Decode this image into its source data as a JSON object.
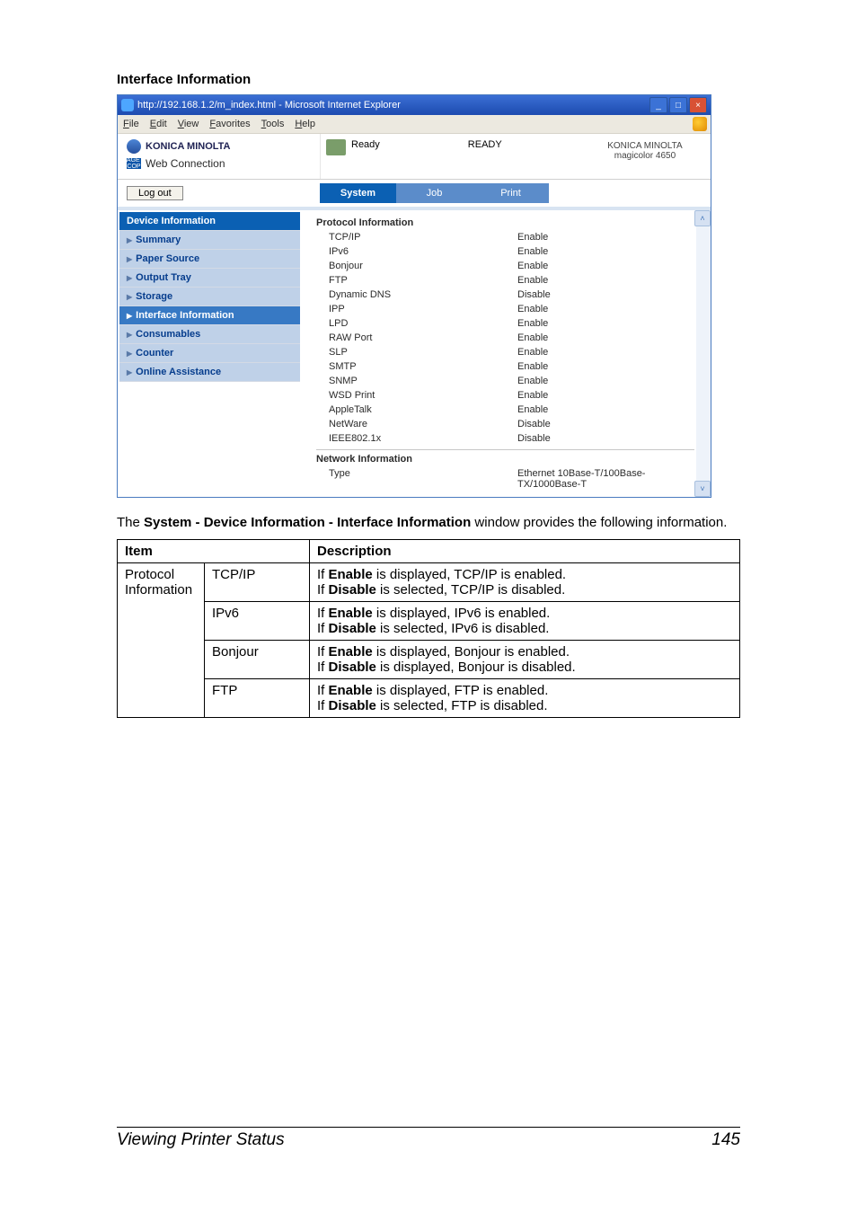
{
  "section_title": "Interface Information",
  "browser": {
    "title": "http://192.168.1.2/m_index.html - Microsoft Internet Explorer",
    "menus": [
      "File",
      "Edit",
      "View",
      "Favorites",
      "Tools",
      "Help"
    ]
  },
  "header": {
    "brand": "KONICA MINOLTA",
    "pagescope_prefix": "PAGE SCOPE",
    "pagescope": "Web Connection",
    "status_label": "Ready",
    "status_big": "READY",
    "device": "KONICA MINOLTA magicolor 4650"
  },
  "logout": "Log out",
  "tabs": {
    "system": "System",
    "job": "Job",
    "print": "Print"
  },
  "sidebar": {
    "header": "Device Information",
    "items": [
      "Summary",
      "Paper Source",
      "Output Tray",
      "Storage",
      "Interface Information",
      "Consumables",
      "Counter",
      "Online Assistance"
    ],
    "active_index": 4
  },
  "panel": {
    "section1": "Protocol Information",
    "rows": [
      {
        "k": "TCP/IP",
        "v": "Enable"
      },
      {
        "k": "IPv6",
        "v": "Enable"
      },
      {
        "k": "Bonjour",
        "v": "Enable"
      },
      {
        "k": "FTP",
        "v": "Enable"
      },
      {
        "k": "Dynamic DNS",
        "v": "Disable"
      },
      {
        "k": "IPP",
        "v": "Enable"
      },
      {
        "k": "LPD",
        "v": "Enable"
      },
      {
        "k": "RAW Port",
        "v": "Enable"
      },
      {
        "k": "SLP",
        "v": "Enable"
      },
      {
        "k": "SMTP",
        "v": "Enable"
      },
      {
        "k": "SNMP",
        "v": "Enable"
      },
      {
        "k": "WSD Print",
        "v": "Enable"
      },
      {
        "k": "AppleTalk",
        "v": "Enable"
      },
      {
        "k": "NetWare",
        "v": "Disable"
      },
      {
        "k": "IEEE802.1x",
        "v": "Disable"
      }
    ],
    "section2": "Network Information",
    "net_type_k": "Type",
    "net_type_v": "Ethernet 10Base-T/100Base-TX/1000Base-T"
  },
  "explain_pre": "The ",
  "explain_bold": "System - Device Information - Interface Information",
  "explain_post": " window provides the following information.",
  "table": {
    "h_item": "Item",
    "h_desc": "Description",
    "group": "Protocol Information",
    "rows": [
      {
        "sub": "TCP/IP",
        "desc_pre": "If ",
        "desc_b1": "Enable",
        "desc_mid": " is displayed, TCP/IP is enabled.\nIf ",
        "desc_b2": "Disable",
        "desc_post": " is selected, TCP/IP is disabled."
      },
      {
        "sub": "IPv6",
        "desc_pre": "If ",
        "desc_b1": "Enable",
        "desc_mid": " is displayed, IPv6 is enabled.\nIf ",
        "desc_b2": "Disable",
        "desc_post": " is selected, IPv6 is disabled."
      },
      {
        "sub": "Bonjour",
        "desc_pre": "If ",
        "desc_b1": "Enable",
        "desc_mid": " is displayed, Bonjour is enabled.\nIf ",
        "desc_b2": "Disable",
        "desc_post": " is displayed, Bonjour is disabled."
      },
      {
        "sub": "FTP",
        "desc_pre": "If ",
        "desc_b1": "Enable",
        "desc_mid": " is displayed, FTP is enabled.\nIf ",
        "desc_b2": "Disable",
        "desc_post": " is selected, FTP is disabled."
      }
    ]
  },
  "footer": {
    "title": "Viewing Printer Status",
    "page": "145"
  }
}
